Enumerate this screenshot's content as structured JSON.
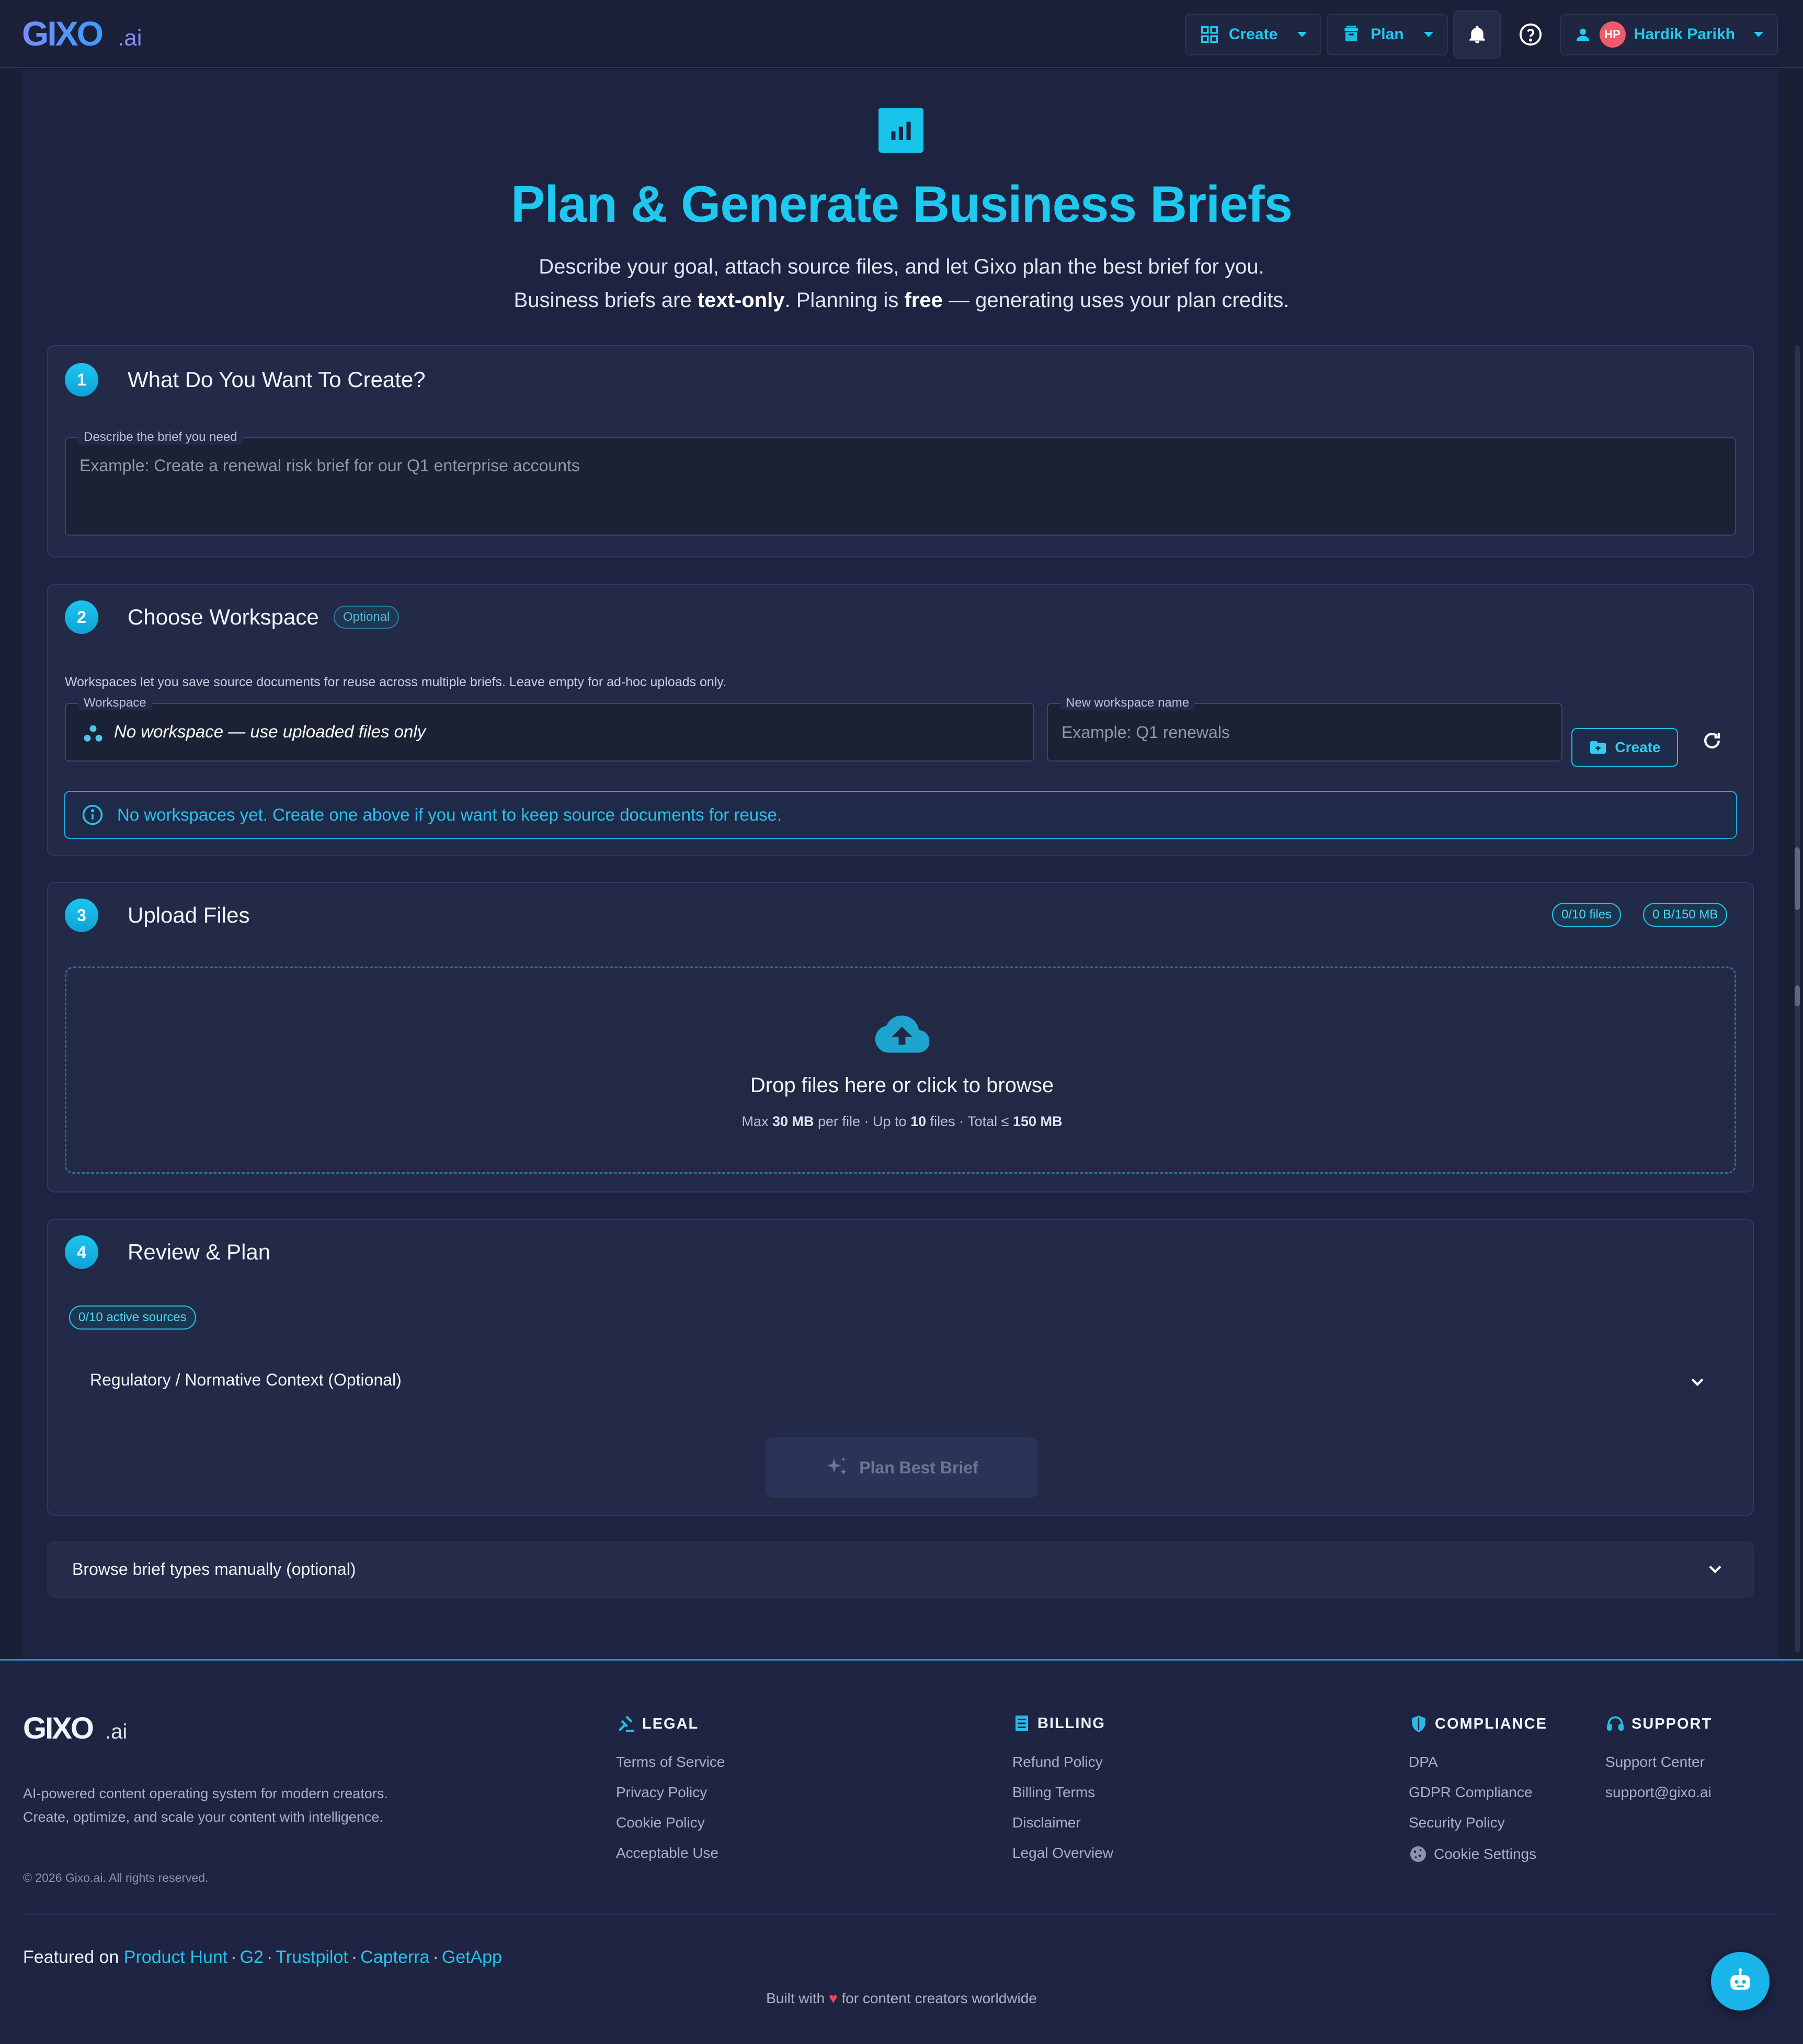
{
  "navbar": {
    "brand": "GIXO",
    "brand_suffix": ".ai",
    "create_label": "Create",
    "plan_label": "Plan",
    "user_initials": "HP",
    "user_name": "Hardik Parikh"
  },
  "hero": {
    "title": "Plan & Generate Business Briefs",
    "subtitle_line1": "Describe your goal, attach source files, and let Gixo plan the best brief for you.",
    "subtitle_line2_a": "Business briefs are ",
    "subtitle_line2_b": "text-only",
    "subtitle_line2_c": ". Planning is ",
    "subtitle_line2_d": "free",
    "subtitle_line2_e": " — generating uses your plan credits."
  },
  "step1": {
    "number": "1",
    "title": "What Do You Want To Create?",
    "field_label": "Describe the brief you need",
    "placeholder": "Example: Create a renewal risk brief for our Q1 enterprise accounts"
  },
  "step2": {
    "number": "2",
    "title": "Choose Workspace",
    "badge": "Optional",
    "helper": "Workspaces let you save source documents for reuse across multiple briefs. Leave empty for ad-hoc uploads only.",
    "workspace_label": "Workspace",
    "workspace_value": "No workspace — use uploaded files only",
    "new_ws_label": "New workspace name",
    "new_ws_placeholder": "Example: Q1 renewals",
    "create_button": "Create",
    "alert": "No workspaces yet. Create one above if you want to keep source documents for reuse."
  },
  "step3": {
    "number": "3",
    "title": "Upload Files",
    "files_count": "0/10 files",
    "size_count": "0 B/150 MB",
    "drop_title": "Drop files here or click to browse",
    "limit_a": "Max ",
    "limit_b": "30 MB",
    "limit_c": " per file · Up to ",
    "limit_d": "10",
    "limit_e": " files · Total ≤ ",
    "limit_f": "150 MB"
  },
  "step4": {
    "number": "4",
    "title": "Review & Plan",
    "sources_badge": "0/10 active sources",
    "regulatory_label": "Regulatory / Normative Context (Optional)",
    "plan_button": "Plan Best Brief"
  },
  "browse": {
    "label": "Browse brief types manually (optional)"
  },
  "footer": {
    "brand": "GIXO",
    "brand_suffix": ".ai",
    "description": "AI-powered content operating system for modern creators. Create, optimize, and scale your content with intelligence.",
    "copyright": "© 2026 Gixo.ai. All rights reserved.",
    "legal": {
      "title": "LEGAL",
      "links": [
        "Terms of Service",
        "Privacy Policy",
        "Cookie Policy",
        "Acceptable Use"
      ]
    },
    "billing": {
      "title": "BILLING",
      "links": [
        "Refund Policy",
        "Billing Terms",
        "Disclaimer",
        "Legal Overview"
      ]
    },
    "compliance": {
      "title": "COMPLIANCE",
      "links": [
        "DPA",
        "GDPR Compliance",
        "Security Policy",
        "Cookie Settings"
      ]
    },
    "support": {
      "title": "SUPPORT",
      "links": [
        "Support Center",
        "support@gixo.ai"
      ]
    },
    "featured_prefix": "Featured on ",
    "featured": [
      "Product Hunt",
      "G2",
      "Trustpilot",
      "Capterra",
      "GetApp"
    ],
    "featured_sep": "·",
    "built_a": "Built with ",
    "built_heart": "♥",
    "built_b": " for content creators worldwide"
  },
  "colors": {
    "accent": "#1ec8ee",
    "background": "#1a1f36",
    "card": "#232a48"
  }
}
